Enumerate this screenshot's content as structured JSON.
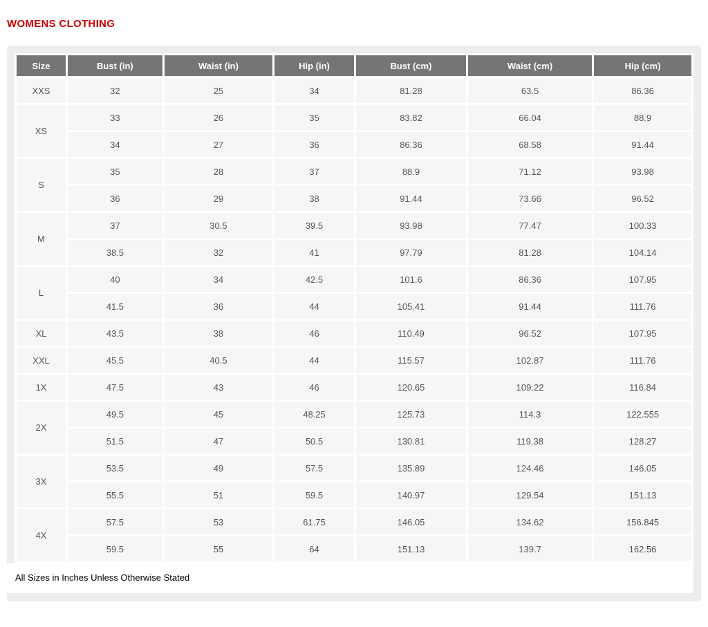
{
  "page": {
    "title": "WOMENS CLOTHING",
    "footnote": "All Sizes in Inches Unless Otherwise Stated"
  },
  "colors": {
    "title_red": "#cc0000",
    "header_bg": "#757575",
    "header_text": "#ffffff",
    "cell_bg": "#f6f6f6",
    "cell_text": "#555555",
    "container_bg": "#ededed"
  },
  "table": {
    "columns": [
      "Size",
      "Bust (in)",
      "Waist (in)",
      "Hip (in)",
      "Bust (cm)",
      "Waist (cm)",
      "Hip (cm)"
    ],
    "groups": [
      {
        "size": "XXS",
        "rows": [
          [
            "32",
            "25",
            "34",
            "81.28",
            "63.5",
            "86.36"
          ]
        ]
      },
      {
        "size": "XS",
        "rows": [
          [
            "33",
            "26",
            "35",
            "83.82",
            "66.04",
            "88.9"
          ],
          [
            "34",
            "27",
            "36",
            "86.36",
            "68.58",
            "91.44"
          ]
        ]
      },
      {
        "size": "S",
        "rows": [
          [
            "35",
            "28",
            "37",
            "88.9",
            "71.12",
            "93.98"
          ],
          [
            "36",
            "29",
            "38",
            "91.44",
            "73.66",
            "96.52"
          ]
        ]
      },
      {
        "size": "M",
        "rows": [
          [
            "37",
            "30.5",
            "39.5",
            "93.98",
            "77.47",
            "100.33"
          ],
          [
            "38.5",
            "32",
            "41",
            "97.79",
            "81.28",
            "104.14"
          ]
        ]
      },
      {
        "size": "L",
        "rows": [
          [
            "40",
            "34",
            "42.5",
            "101.6",
            "86.36",
            "107.95"
          ],
          [
            "41.5",
            "36",
            "44",
            "105.41",
            "91.44",
            "111.76"
          ]
        ]
      },
      {
        "size": "XL",
        "rows": [
          [
            "43.5",
            "38",
            "46",
            "110.49",
            "96.52",
            "107.95"
          ]
        ]
      },
      {
        "size": "XXL",
        "rows": [
          [
            "45.5",
            "40.5",
            "44",
            "115.57",
            "102.87",
            "111.76"
          ]
        ]
      },
      {
        "size": "1X",
        "rows": [
          [
            "47.5",
            "43",
            "46",
            "120.65",
            "109.22",
            "116.84"
          ]
        ]
      },
      {
        "size": "2X",
        "rows": [
          [
            "49.5",
            "45",
            "48.25",
            "125.73",
            "114.3",
            "122.555"
          ],
          [
            "51.5",
            "47",
            "50.5",
            "130.81",
            "119.38",
            "128.27"
          ]
        ]
      },
      {
        "size": "3X",
        "rows": [
          [
            "53.5",
            "49",
            "57.5",
            "135.89",
            "124.46",
            "146.05"
          ],
          [
            "55.5",
            "51",
            "59.5",
            "140.97",
            "129.54",
            "151.13"
          ]
        ]
      },
      {
        "size": "4X",
        "rows": [
          [
            "57.5",
            "53",
            "61.75",
            "146.05",
            "134.62",
            "156.845"
          ],
          [
            "59.5",
            "55",
            "64",
            "151.13",
            "139.7",
            "162.56"
          ]
        ]
      }
    ]
  }
}
